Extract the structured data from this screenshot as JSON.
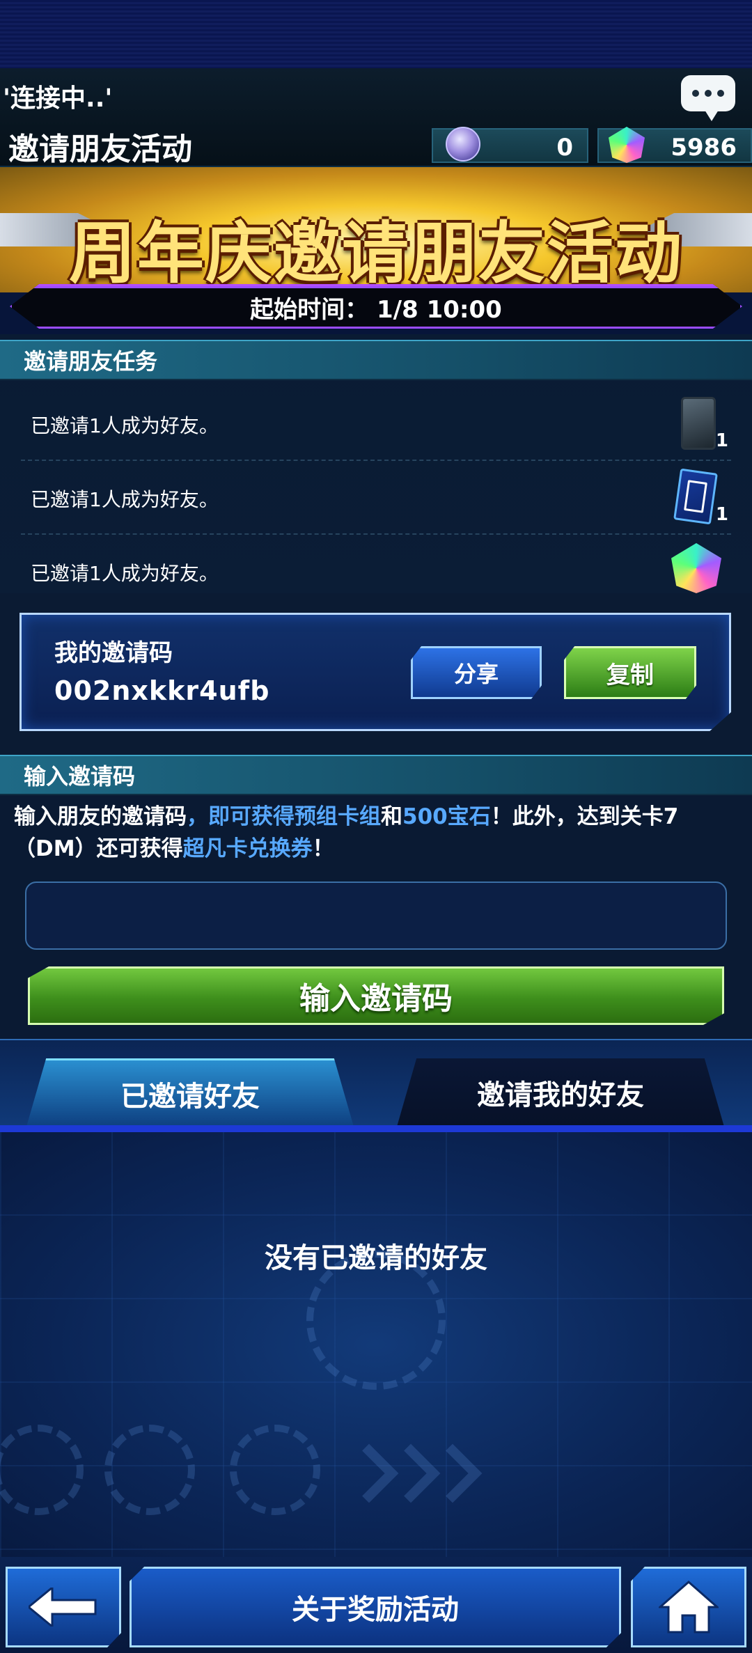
{
  "status": {
    "connecting_text": "'连接中..'"
  },
  "header": {
    "title": "邀请朋友活动",
    "orb_currency": "0",
    "gem_currency": "5986"
  },
  "banner": {
    "title": "周年庆邀请朋友活动",
    "start_time": "起始时间： 1/8 10:00"
  },
  "missions": {
    "heading": "邀请朋友任务",
    "items": [
      {
        "text": "已邀请1人成为好友。",
        "reward_count": "1",
        "reward_icon": "card-pack-icon"
      },
      {
        "text": "已邀请1人成为好友。",
        "reward_count": "1",
        "reward_icon": "card-ticket-icon"
      },
      {
        "text": "已邀请1人成为好友。",
        "reward_count": "",
        "reward_icon": "gem-icon"
      }
    ]
  },
  "my_code": {
    "label": "我的邀请码",
    "value": "002nxkkr4ufb",
    "share_label": "分享",
    "copy_label": "复制"
  },
  "enter_code": {
    "heading": "输入邀请码",
    "desc_1": "输入朋友的邀请码",
    "desc_2": "，即可获得预组卡组",
    "desc_3": "和",
    "desc_4": "500宝石",
    "desc_5": "！此外，达到关卡7（DM）还可获得",
    "desc_6": "超凡卡兑换券",
    "desc_7": "！",
    "input_value": "",
    "button_label": "输入邀请码"
  },
  "tabs": [
    {
      "label": "已邀请好友",
      "active": true
    },
    {
      "label": "邀请我的好友",
      "active": false
    }
  ],
  "friend_list": {
    "empty_text": "没有已邀请的好友"
  },
  "footer": {
    "about_label": "关于奖励活动",
    "back_icon": "arrow-left-icon",
    "home_icon": "home-icon"
  },
  "colors": {
    "highlight": "#58a9ff",
    "green_button": "#3e8f1c",
    "blue_button": "#1a5cc8",
    "background": "#07153a"
  }
}
